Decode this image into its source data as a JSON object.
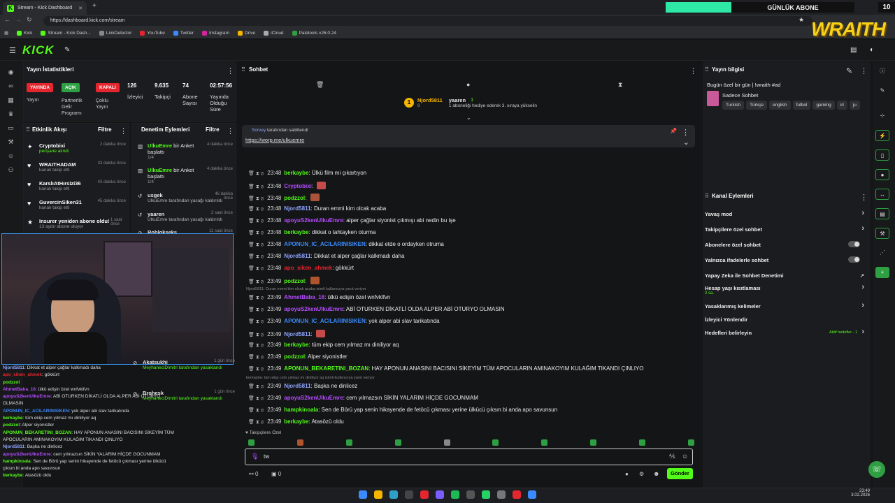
{
  "browser": {
    "tab_title": "Stream - Kick Dashboard",
    "url": "https://dashboard.kick.com/stream",
    "bookmarks": [
      "Kick",
      "Stream - Kick Dash...",
      "LinkDetector",
      "YouTube",
      "Twitter",
      "Instagram",
      "Drive",
      "iCloud",
      "Paletools v26.0.24"
    ]
  },
  "overlay": {
    "label": "GÜNLÜK ABONE",
    "count": "10",
    "brand": "WRAITH"
  },
  "stats": {
    "title": "Yayın İstatistikleri",
    "status_badges": [
      {
        "value": "YAYINDA",
        "label": "Yayın",
        "color": "#e5262f"
      },
      {
        "value": "AÇIK",
        "label": "Partnerlik Gelir Programı",
        "color": "#2ea043"
      },
      {
        "value": "KAPALI",
        "label": "Çoklu Yayın",
        "color": "#e5262f"
      }
    ],
    "numbers": [
      {
        "value": "126",
        "label": "İzleyici"
      },
      {
        "value": "9.635",
        "label": "Takipçi"
      },
      {
        "value": "74",
        "label": "Abone Sayısı"
      },
      {
        "value": "02:57:56",
        "label": "Yayında Olduğu Süre"
      }
    ]
  },
  "activity": {
    "title": "Etkinlik Akışı",
    "filter": "Filtre",
    "items": [
      {
        "name": "Cryptobixi",
        "detail": "perişane alındı",
        "time": "2 dakika önce"
      },
      {
        "name": "WRAITHADAM",
        "detail": "kanalı takip etti",
        "time": "33 dakika önce"
      },
      {
        "name": "KarslıAtHırsizi36",
        "detail": "kanalı takip etti",
        "time": "43 dakika önce"
      },
      {
        "name": "GuvercinSiken31",
        "detail": "kanalı takip etti",
        "time": "45 dakika önce"
      },
      {
        "name": "Insurer yeniden abone oldu!",
        "detail": "13 aydır abone oluyor",
        "time": "1 saat önce"
      }
    ]
  },
  "moderation": {
    "title": "Denetim Eylemleri",
    "filter": "Filtre",
    "items": [
      {
        "actor": "UlkuEmre",
        "action": "bir Anket başlattı",
        "detail": "1/4",
        "time": "4 dakika önce"
      },
      {
        "actor": "UlkuEmre",
        "action": "bir Anket başlattı",
        "detail": "1/4",
        "time": "4 dakika önce"
      },
      {
        "actor": "usgek",
        "action": "UlkuEmre tarafından yasağı kaldırıldı",
        "detail": "",
        "time": "46 dakika önce"
      },
      {
        "actor": "yaaren",
        "action": "UlkuEmre tarafından yasağı kaldırıldı",
        "detail": "",
        "time": "2 saat önce"
      },
      {
        "actor": "Robloksekş",
        "action": "",
        "detail": "",
        "time": "11 saat önce"
      },
      {
        "actor": "Akatsukhi",
        "action": "MeyhaneciDimitri tarafından yasaklandı",
        "detail": "",
        "time": "1 gün önce"
      },
      {
        "actor": "Brohesk",
        "action": "MeyhaneciDimitri tarafından yasaklandı",
        "detail": "",
        "time": "1 gün önce"
      }
    ]
  },
  "chat": {
    "title": "Sohbet",
    "top_gifter": {
      "name": "Njord5811",
      "count": "9",
      "target": "yaaren",
      "text": "1 aboneliği hediye ederek 3. sıraya yükselin",
      "gift": "1"
    },
    "pinned": {
      "by": "Sorvey",
      "suffix": "tarafından sabitlendi",
      "link": "https://worp.me/ulkuemre"
    },
    "messages": [
      {
        "time": "23:48",
        "user": "berkaybe",
        "color": "#53fc18",
        "text": "Ülkü film mi çıkartıyon",
        "emote": false
      },
      {
        "time": "23:48",
        "user": "Cryptobixi",
        "color": "#b44cff",
        "text": "",
        "emote": true
      },
      {
        "time": "23:48",
        "user": "podzzol",
        "color": "#53fc18",
        "text": "",
        "emote": true
      },
      {
        "time": "23:48",
        "user": "Njord5811",
        "color": "#8ea4ff",
        "text": "Duran emmi kim olcak acaba",
        "emote": false
      },
      {
        "time": "23:48",
        "user": "apoyuS2kenUlkuEmre",
        "color": "#b44cff",
        "text": "alper çağlar siyonist çıkmışı abi nedin bu işe",
        "emote": false
      },
      {
        "time": "23:48",
        "user": "berkaybe",
        "color": "#53fc18",
        "text": "dikkat o tahtayken oturma",
        "emote": false
      },
      {
        "time": "23:48",
        "user": "APONUN_IC_ACILARINISIKEN",
        "color": "#3a8bff",
        "text": "dikkat etde o ordayken otruma",
        "emote": false
      },
      {
        "time": "23:48",
        "user": "Njord5811",
        "color": "#8ea4ff",
        "text": "Dikkat et alper çağlar kalkmadı daha",
        "emote": false
      },
      {
        "time": "23:48",
        "user": "apo_siken_ahmek",
        "color": "#e5262f",
        "text": "gökkürt",
        "emote": false
      },
      {
        "time": "23:49",
        "user": "podzzol",
        "color": "#53fc18",
        "text": "",
        "emote": true
      },
      {
        "time": "23:49",
        "user": "AhmetBaba_16",
        "color": "#b44cff",
        "text": "ülkü edişin özel wnfvklfvn",
        "emote": false
      },
      {
        "time": "23:49",
        "user": "apoyuS2kenUlkuEmre",
        "color": "#b44cff",
        "text": "ABİ OTURKEN DİKATLİ OLDA ALPER ABİ OTURYO OLMASIN",
        "emote": false
      },
      {
        "time": "23:49",
        "user": "APONUN_IC_ACILARINISIKEN",
        "color": "#3a8bff",
        "text": "yok alper abi slav tarikatında",
        "emote": false
      },
      {
        "time": "23:49",
        "user": "Njord5811",
        "color": "#8ea4ff",
        "text": "",
        "emote": true
      },
      {
        "time": "23:49",
        "user": "berkaybe",
        "color": "#53fc18",
        "text": "tüm ekip cem yılmaz mı diniliyor aq",
        "emote": false
      },
      {
        "time": "23:49",
        "user": "podzzol",
        "color": "#53fc18",
        "text": "Alper siyonistler",
        "emote": false
      },
      {
        "time": "23:49",
        "user": "APONUN_BEKARETINI_BOZAN",
        "color": "#53fc18",
        "text": "HAY APONUN ANASINI BACISINI SİKEYİM TÜM APOCULARIN AMINAKOYIM KULAĞIM TIKANDI ÇINLIYO",
        "emote": false
      },
      {
        "time": "23:49",
        "user": "Njord5811",
        "color": "#8ea4ff",
        "text": "Başka ne dinlicez",
        "emote": false
      },
      {
        "time": "23:49",
        "user": "apoyuS2kenUlkuEmre",
        "color": "#b44cff",
        "text": "cem yılmazsın SİKİN YALARIM HİÇDE GOCUNMAM",
        "emote": false
      },
      {
        "time": "23:49",
        "user": "hampkinoala",
        "color": "#53fc18",
        "text": "Sen de Börü yap senin hikayende de fetöcü çıkması yerine ülkücü çıksın bi anda apo savunsun",
        "emote": false
      },
      {
        "time": "23:49",
        "user": "berkaybe",
        "color": "#53fc18",
        "text": "Atasözü oldu",
        "emote": false
      }
    ],
    "reply_notes": [
      "Njord5811: Duran emmi kim olcak acaba isimli kullanıcıya yanıt veriyor",
      "berkaybe: tüm ekip cem yılmaz mı diniliyor aq isimli kullanıcıya yanıt veriyor"
    ],
    "followers_only": "Takipçilere Özel",
    "input_value": "tw",
    "send_label": "Gönder",
    "count_a": "0",
    "count_b": "0"
  },
  "stream_info": {
    "title": "Yayın bilgisi",
    "stream_title": "Bugün özel bir gün | !wraith #ad",
    "category": "Sadece Sohbet",
    "tags": [
      "Turkish",
      "Türkçe",
      "english",
      "futbol",
      "gaming",
      "irl",
      "ju"
    ]
  },
  "channel_actions": {
    "title": "Kanal Eylemleri",
    "rows": [
      {
        "label": "Yavaş mod",
        "kind": "arrow",
        "sub": ""
      },
      {
        "label": "Takipçilere özel sohbet",
        "kind": "arrow",
        "sub": ""
      },
      {
        "label": "Abonelere özel sohbet",
        "kind": "toggle",
        "sub": ""
      },
      {
        "label": "Yalnızca ifadelerle sohbet",
        "kind": "toggle",
        "sub": ""
      },
      {
        "label": "Yapay Zeka ile Sohbet Denetimi",
        "kind": "ext",
        "sub": ""
      },
      {
        "label": "Hesap yaşı kısıtlaması",
        "kind": "arrow",
        "sub": "2 sa."
      },
      {
        "label": "Yasaklanmış kelimeler",
        "kind": "arrow",
        "sub": ""
      },
      {
        "label": "İzleyici Yönlendir",
        "kind": "none",
        "sub": ""
      },
      {
        "label": "Hedefleri belirleyin",
        "kind": "arrow",
        "sub": "Aktif hedefler - 1"
      }
    ]
  },
  "taskbar": {
    "time": "23:49",
    "date": "3.02.2026"
  }
}
